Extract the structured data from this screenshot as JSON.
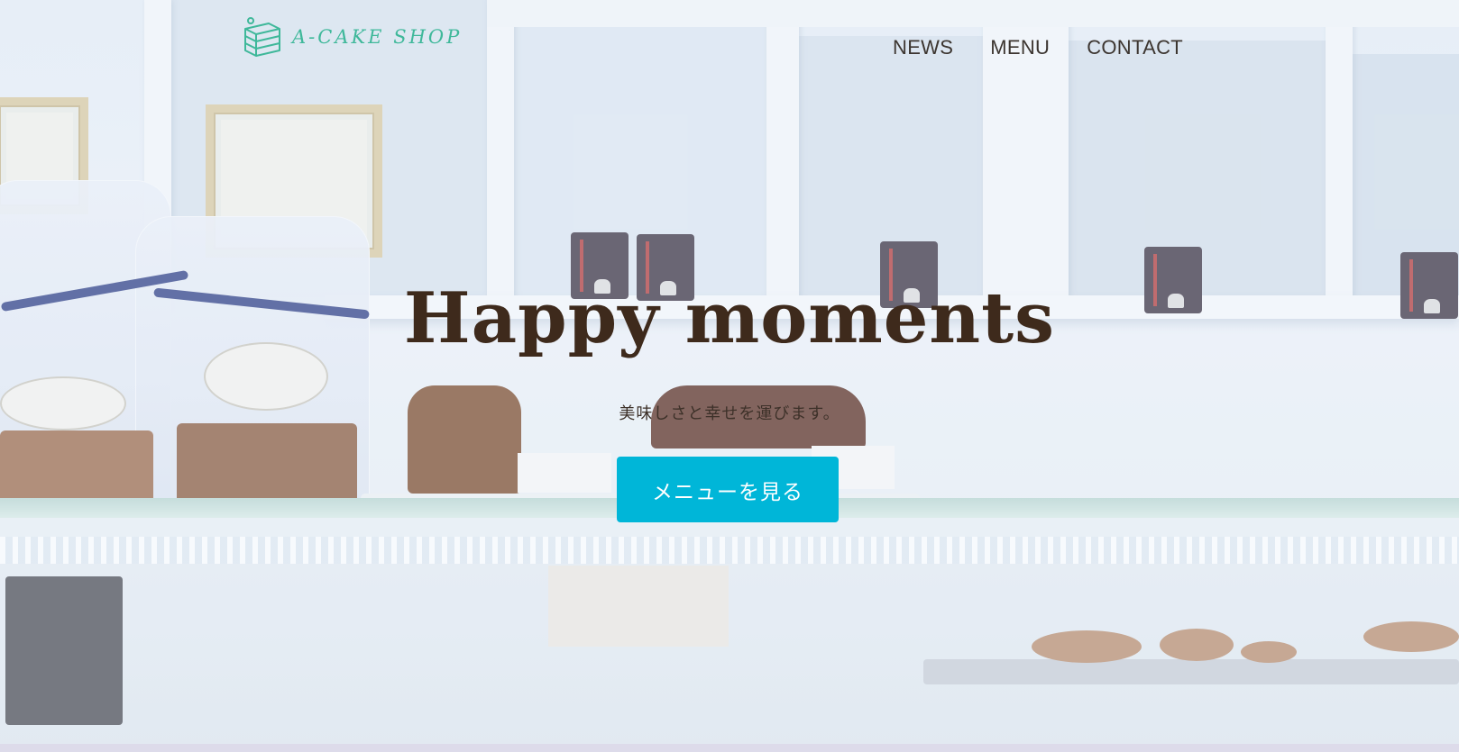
{
  "header": {
    "logo_text": "A-CAKE SHOP",
    "logo_icon": "cake-slice-icon",
    "logo_color": "#3fb89a"
  },
  "nav": {
    "items": [
      {
        "label": "NEWS"
      },
      {
        "label": "MENU"
      },
      {
        "label": "CONTACT"
      }
    ]
  },
  "hero": {
    "title": "Happy moments",
    "subtitle": "美味しさと幸せを運びます。",
    "cta_label": "メニューを見る",
    "cta_color": "#00b6d8",
    "title_color": "#3e2a1c"
  }
}
